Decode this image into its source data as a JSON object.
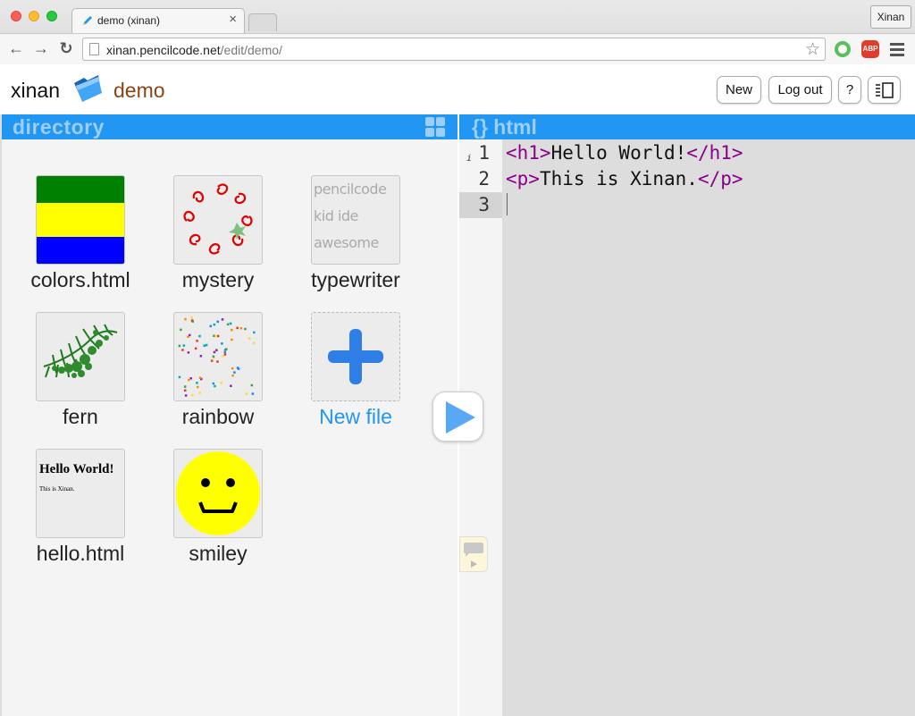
{
  "browser": {
    "tab_title": "demo (xinan)",
    "profile": "Xinan",
    "url_host": "xinan.pencilcode.net",
    "url_path": "/edit/demo/",
    "abp_label": "ABP"
  },
  "header": {
    "user": "xinan",
    "project": "demo",
    "buttons": {
      "new": "New",
      "logout": "Log out",
      "help": "?"
    }
  },
  "directory": {
    "title": "directory",
    "files": [
      {
        "label": "colors.html"
      },
      {
        "label": "mystery"
      },
      {
        "label": "typewriter",
        "thumb_lines": [
          "pencilcode",
          "kid ide",
          "awesome"
        ]
      },
      {
        "label": "fern"
      },
      {
        "label": "rainbow"
      },
      {
        "label": "New file"
      },
      {
        "label": "hello.html",
        "thumb_heading": "Hello World!",
        "thumb_text": "This is Xinan."
      },
      {
        "label": "smiley"
      }
    ]
  },
  "editor": {
    "title": "{} html",
    "line_numbers": [
      "1",
      "2",
      "3"
    ],
    "lines": [
      {
        "open": "<h1>",
        "text": "Hello World!",
        "close": "</h1>"
      },
      {
        "open": "<p>",
        "text": "This is Xinan.",
        "close": "</p>"
      }
    ],
    "info_mark": "i"
  }
}
